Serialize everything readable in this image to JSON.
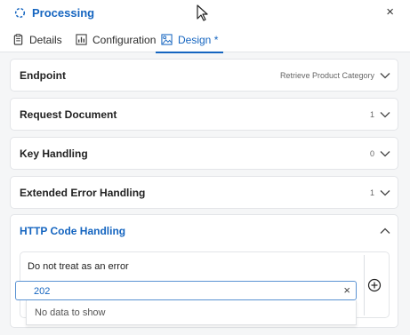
{
  "header": {
    "title": "Processing",
    "close_glyph": "×",
    "spinner_icon": "spinner-icon"
  },
  "tabs": [
    {
      "label": "Details",
      "icon": "clipboard-icon"
    },
    {
      "label": "Configuration",
      "icon": "bar-chart-icon"
    },
    {
      "label": "Design *",
      "icon": "design-icon",
      "active": true
    }
  ],
  "accordion": [
    {
      "label": "Endpoint",
      "value": "Retrieve Product Category"
    },
    {
      "label": "Request Document",
      "value": "1"
    },
    {
      "label": "Key Handling",
      "value": "0"
    },
    {
      "label": "Extended Error Handling",
      "value": "1"
    },
    {
      "label": "HTTP Code Handling",
      "expanded": true
    }
  ],
  "http_code": {
    "label": "Do not treat as an error",
    "input_value": "202",
    "clear_glyph": "×",
    "dropdown_empty": "No data to show"
  },
  "colors": {
    "accent": "#1565c0",
    "border": "#e3e5e8",
    "background": "#f5f6f7"
  }
}
